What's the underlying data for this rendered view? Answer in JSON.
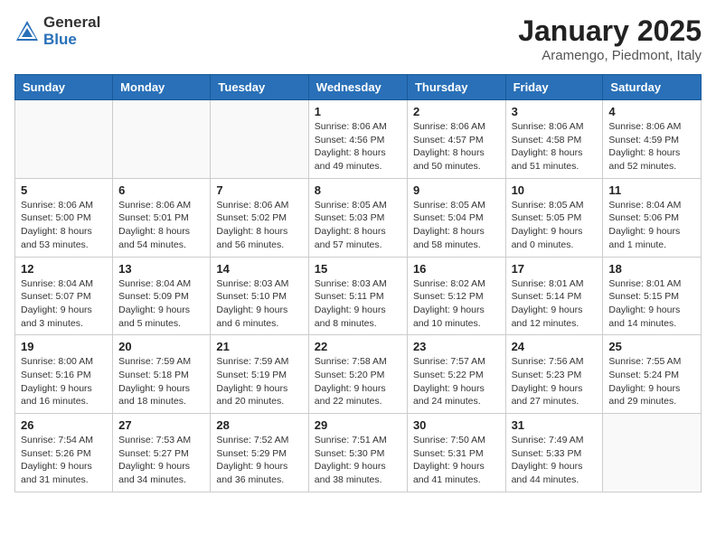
{
  "logo": {
    "general": "General",
    "blue": "Blue"
  },
  "header": {
    "title": "January 2025",
    "subtitle": "Aramengo, Piedmont, Italy"
  },
  "weekdays": [
    "Sunday",
    "Monday",
    "Tuesday",
    "Wednesday",
    "Thursday",
    "Friday",
    "Saturday"
  ],
  "weeks": [
    [
      {
        "day": "",
        "info": ""
      },
      {
        "day": "",
        "info": ""
      },
      {
        "day": "",
        "info": ""
      },
      {
        "day": "1",
        "info": "Sunrise: 8:06 AM\nSunset: 4:56 PM\nDaylight: 8 hours\nand 49 minutes."
      },
      {
        "day": "2",
        "info": "Sunrise: 8:06 AM\nSunset: 4:57 PM\nDaylight: 8 hours\nand 50 minutes."
      },
      {
        "day": "3",
        "info": "Sunrise: 8:06 AM\nSunset: 4:58 PM\nDaylight: 8 hours\nand 51 minutes."
      },
      {
        "day": "4",
        "info": "Sunrise: 8:06 AM\nSunset: 4:59 PM\nDaylight: 8 hours\nand 52 minutes."
      }
    ],
    [
      {
        "day": "5",
        "info": "Sunrise: 8:06 AM\nSunset: 5:00 PM\nDaylight: 8 hours\nand 53 minutes."
      },
      {
        "day": "6",
        "info": "Sunrise: 8:06 AM\nSunset: 5:01 PM\nDaylight: 8 hours\nand 54 minutes."
      },
      {
        "day": "7",
        "info": "Sunrise: 8:06 AM\nSunset: 5:02 PM\nDaylight: 8 hours\nand 56 minutes."
      },
      {
        "day": "8",
        "info": "Sunrise: 8:05 AM\nSunset: 5:03 PM\nDaylight: 8 hours\nand 57 minutes."
      },
      {
        "day": "9",
        "info": "Sunrise: 8:05 AM\nSunset: 5:04 PM\nDaylight: 8 hours\nand 58 minutes."
      },
      {
        "day": "10",
        "info": "Sunrise: 8:05 AM\nSunset: 5:05 PM\nDaylight: 9 hours\nand 0 minutes."
      },
      {
        "day": "11",
        "info": "Sunrise: 8:04 AM\nSunset: 5:06 PM\nDaylight: 9 hours\nand 1 minute."
      }
    ],
    [
      {
        "day": "12",
        "info": "Sunrise: 8:04 AM\nSunset: 5:07 PM\nDaylight: 9 hours\nand 3 minutes."
      },
      {
        "day": "13",
        "info": "Sunrise: 8:04 AM\nSunset: 5:09 PM\nDaylight: 9 hours\nand 5 minutes."
      },
      {
        "day": "14",
        "info": "Sunrise: 8:03 AM\nSunset: 5:10 PM\nDaylight: 9 hours\nand 6 minutes."
      },
      {
        "day": "15",
        "info": "Sunrise: 8:03 AM\nSunset: 5:11 PM\nDaylight: 9 hours\nand 8 minutes."
      },
      {
        "day": "16",
        "info": "Sunrise: 8:02 AM\nSunset: 5:12 PM\nDaylight: 9 hours\nand 10 minutes."
      },
      {
        "day": "17",
        "info": "Sunrise: 8:01 AM\nSunset: 5:14 PM\nDaylight: 9 hours\nand 12 minutes."
      },
      {
        "day": "18",
        "info": "Sunrise: 8:01 AM\nSunset: 5:15 PM\nDaylight: 9 hours\nand 14 minutes."
      }
    ],
    [
      {
        "day": "19",
        "info": "Sunrise: 8:00 AM\nSunset: 5:16 PM\nDaylight: 9 hours\nand 16 minutes."
      },
      {
        "day": "20",
        "info": "Sunrise: 7:59 AM\nSunset: 5:18 PM\nDaylight: 9 hours\nand 18 minutes."
      },
      {
        "day": "21",
        "info": "Sunrise: 7:59 AM\nSunset: 5:19 PM\nDaylight: 9 hours\nand 20 minutes."
      },
      {
        "day": "22",
        "info": "Sunrise: 7:58 AM\nSunset: 5:20 PM\nDaylight: 9 hours\nand 22 minutes."
      },
      {
        "day": "23",
        "info": "Sunrise: 7:57 AM\nSunset: 5:22 PM\nDaylight: 9 hours\nand 24 minutes."
      },
      {
        "day": "24",
        "info": "Sunrise: 7:56 AM\nSunset: 5:23 PM\nDaylight: 9 hours\nand 27 minutes."
      },
      {
        "day": "25",
        "info": "Sunrise: 7:55 AM\nSunset: 5:24 PM\nDaylight: 9 hours\nand 29 minutes."
      }
    ],
    [
      {
        "day": "26",
        "info": "Sunrise: 7:54 AM\nSunset: 5:26 PM\nDaylight: 9 hours\nand 31 minutes."
      },
      {
        "day": "27",
        "info": "Sunrise: 7:53 AM\nSunset: 5:27 PM\nDaylight: 9 hours\nand 34 minutes."
      },
      {
        "day": "28",
        "info": "Sunrise: 7:52 AM\nSunset: 5:29 PM\nDaylight: 9 hours\nand 36 minutes."
      },
      {
        "day": "29",
        "info": "Sunrise: 7:51 AM\nSunset: 5:30 PM\nDaylight: 9 hours\nand 38 minutes."
      },
      {
        "day": "30",
        "info": "Sunrise: 7:50 AM\nSunset: 5:31 PM\nDaylight: 9 hours\nand 41 minutes."
      },
      {
        "day": "31",
        "info": "Sunrise: 7:49 AM\nSunset: 5:33 PM\nDaylight: 9 hours\nand 44 minutes."
      },
      {
        "day": "",
        "info": ""
      }
    ]
  ]
}
